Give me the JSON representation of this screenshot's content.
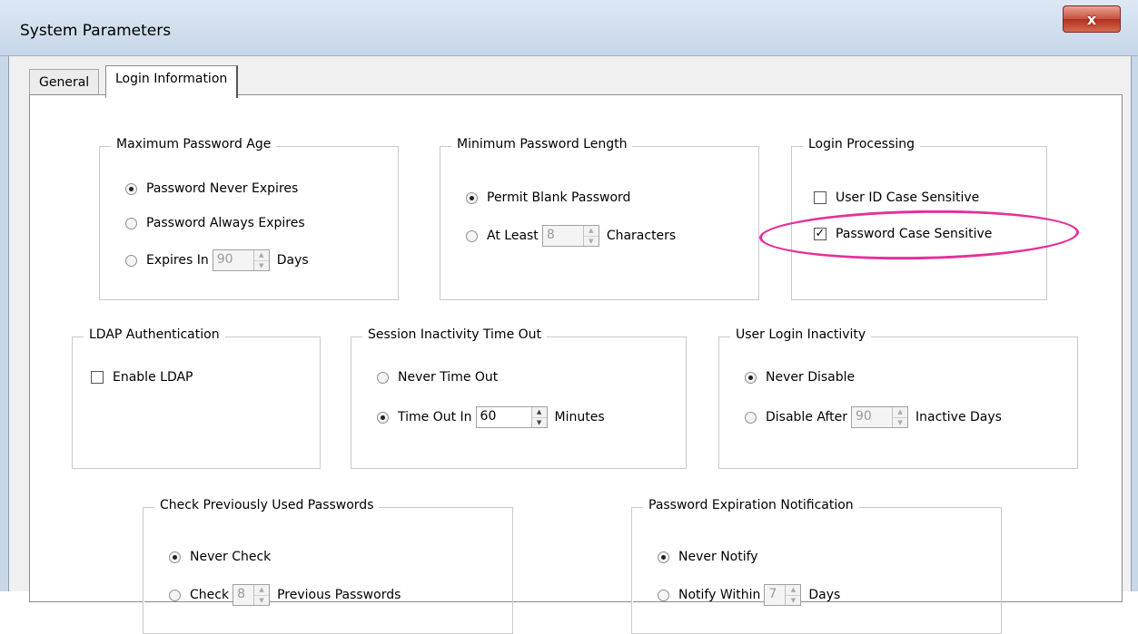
{
  "window": {
    "title": "System Parameters",
    "close_label": "x"
  },
  "tabs": [
    {
      "label": "General"
    },
    {
      "label": "Login Information"
    }
  ],
  "max_password_age": {
    "legend": "Maximum Password Age",
    "never_expires": "Password Never Expires",
    "always_expires": "Password Always Expires",
    "expires_in": "Expires In",
    "expires_value": "90",
    "days": "Days"
  },
  "min_password_length": {
    "legend": "Minimum Password Length",
    "permit_blank": "Permit Blank Password",
    "at_least": "At Least",
    "at_least_value": "8",
    "characters": "Characters"
  },
  "login_processing": {
    "legend": "Login Processing",
    "user_id_case": "User ID Case Sensitive",
    "password_case": "Password Case Sensitive"
  },
  "ldap": {
    "legend": "LDAP Authentication",
    "enable": "Enable LDAP"
  },
  "session_timeout": {
    "legend": "Session Inactivity Time Out",
    "never": "Never Time Out",
    "time_out_in": "Time Out In",
    "value": "60",
    "minutes": "Minutes"
  },
  "user_login_inactivity": {
    "legend": "User Login Inactivity",
    "never_disable": "Never Disable",
    "disable_after": "Disable After",
    "value": "90",
    "inactive_days": "Inactive Days"
  },
  "previous_passwords": {
    "legend": "Check Previously Used Passwords",
    "never_check": "Never Check",
    "check": "Check",
    "value": "8",
    "previous": "Previous Passwords"
  },
  "expiration_notification": {
    "legend": "Password Expiration Notification",
    "never_notify": "Never Notify",
    "notify_within": "Notify Within",
    "value": "7",
    "days": "Days"
  },
  "colors": {
    "highlight": "#e5309a"
  }
}
